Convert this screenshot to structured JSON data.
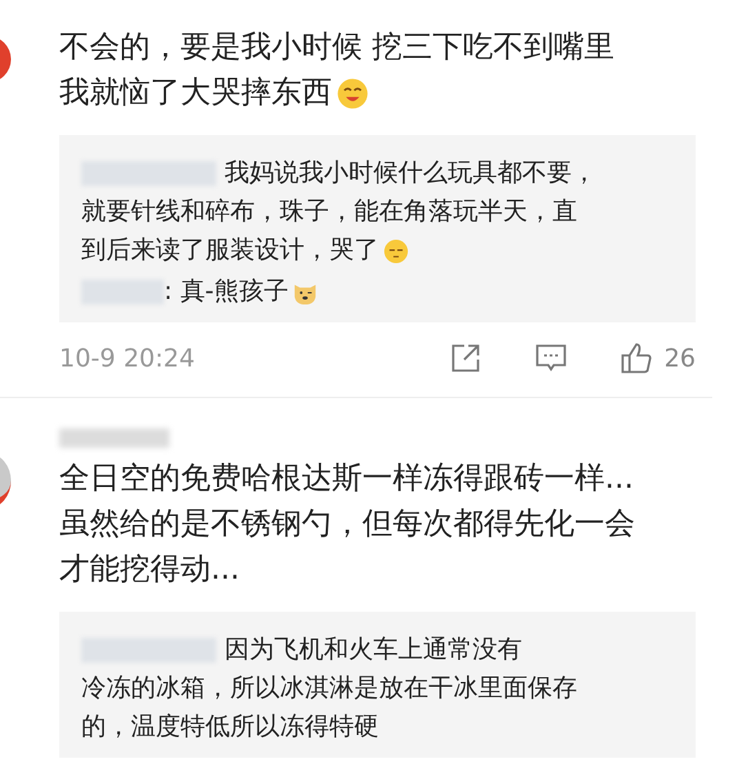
{
  "comments": [
    {
      "lines": [
        "不会的，要是我小时候 挖三下吃不到嘴里",
        "我就恼了大哭摔东西"
      ],
      "emoji": true,
      "replies": [
        {
          "lines": [
            "我妈说我小时候什么玩具都不要，",
            "就要针线和碎布，珠子，能在角落玩半天，直",
            "到后来读了服装设计，哭了"
          ],
          "emoji": true
        },
        {
          "lines": [
            ": 真-熊孩子"
          ],
          "emoji": true
        }
      ],
      "time": "10-9 20:24",
      "likes": "26"
    },
    {
      "username_blurred": true,
      "lines": [
        "全日空的免费哈根达斯一样冻得跟砖一样...",
        "虽然给的是不锈钢勺，但每次都得先化一会",
        "才能挖得动..."
      ],
      "replies": [
        {
          "lines": [
            "因为飞机和火车上通常没有",
            "冷冻的冰箱，所以冰淇淋是放在干冰里面保存",
            "的，温度特低所以冻得特硬"
          ]
        }
      ]
    }
  ]
}
